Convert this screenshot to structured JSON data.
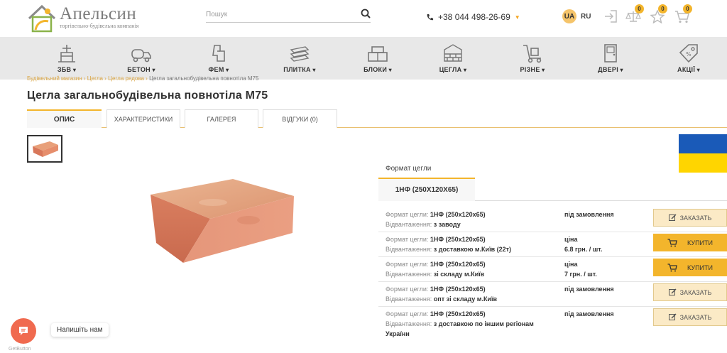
{
  "header": {
    "logo_name": "Апельсин",
    "logo_subtitle": "торгівельно-будівельна компанія",
    "search_placeholder": "Пошук",
    "phone": "+38 044 498-26-69",
    "lang_active": "UA",
    "lang_other": "RU",
    "compare_count": "0",
    "favorites_count": "0",
    "cart_count": "0"
  },
  "nav": {
    "items": [
      {
        "label": "ЗБВ",
        "icon": "crane-icon"
      },
      {
        "label": "БЕТОН",
        "icon": "mixer-truck-icon"
      },
      {
        "label": "ФЕМ",
        "icon": "paving-icon"
      },
      {
        "label": "ПЛИТКА",
        "icon": "tiles-icon"
      },
      {
        "label": "БЛОКИ",
        "icon": "blocks-icon"
      },
      {
        "label": "ЦЕГЛА",
        "icon": "bricks-icon"
      },
      {
        "label": "РІЗНЕ",
        "icon": "cart-dolly-icon"
      },
      {
        "label": "ДВЕРІ",
        "icon": "door-icon"
      },
      {
        "label": "АКЦІЇ",
        "icon": "sale-tag-icon"
      }
    ]
  },
  "breadcrumb": {
    "parts": "Будівельний магазин › Цегла › Цегла рядова ›",
    "current": "Цегла загальнобудівельна повнотіла М75"
  },
  "product": {
    "title": "Цегла загальнобудівельна повнотіла М75"
  },
  "tabs": [
    "ОПИС",
    "ХАРАКТЕРИСТИКИ",
    "ГАЛЕРЕЯ",
    "ВІДГУКИ (0)"
  ],
  "format": {
    "label": "Формат цегли",
    "selected": "1НФ (250Х120Х65)"
  },
  "offers": [
    {
      "fmt_label": "Формат цегли:",
      "fmt": "1НФ (250х120х65)",
      "ship_label": "Відвантаження:",
      "ship": "з заводу",
      "status1": "під замовлення",
      "status2": "",
      "button": "ЗАКАЗАТЬ",
      "type": "order"
    },
    {
      "fmt_label": "Формат цегли:",
      "fmt": "1НФ (250х120х65)",
      "ship_label": "Відвантаження:",
      "ship": "з доставкою м.Київ (22т)",
      "status1": "ціна",
      "status2": "6.8 грн. / шт.",
      "button": "КУПИТИ",
      "type": "buy"
    },
    {
      "fmt_label": "Формат цегли:",
      "fmt": "1НФ (250х120х65)",
      "ship_label": "Відвантаження:",
      "ship": "зі складу м.Київ",
      "status1": "ціна",
      "status2": "7 грн. / шт.",
      "button": "КУПИТИ",
      "type": "buy"
    },
    {
      "fmt_label": "Формат цегли:",
      "fmt": "1НФ (250х120х65)",
      "ship_label": "Відвантаження:",
      "ship": "опт зі складу м.Київ",
      "status1": "під замовлення",
      "status2": "",
      "button": "ЗАКАЗАТЬ",
      "type": "order"
    },
    {
      "fmt_label": "Формат цегли:",
      "fmt": "1НФ (250х120х65)",
      "ship_label": "Відвантаження:",
      "ship": "з доставкою по іншим регіонам України",
      "status1": "під замовлення",
      "status2": "",
      "button": "ЗАКАЗАТЬ",
      "type": "order"
    }
  ],
  "widget": {
    "chat_label": "Напишіть нам",
    "brand": "GetButton"
  },
  "colors": {
    "accent": "#f3b52c",
    "nav_bg": "#e8e8e8",
    "flag_blue": "#1a5ab8",
    "flag_yellow": "#ffd500",
    "chat": "#f06a4f"
  }
}
